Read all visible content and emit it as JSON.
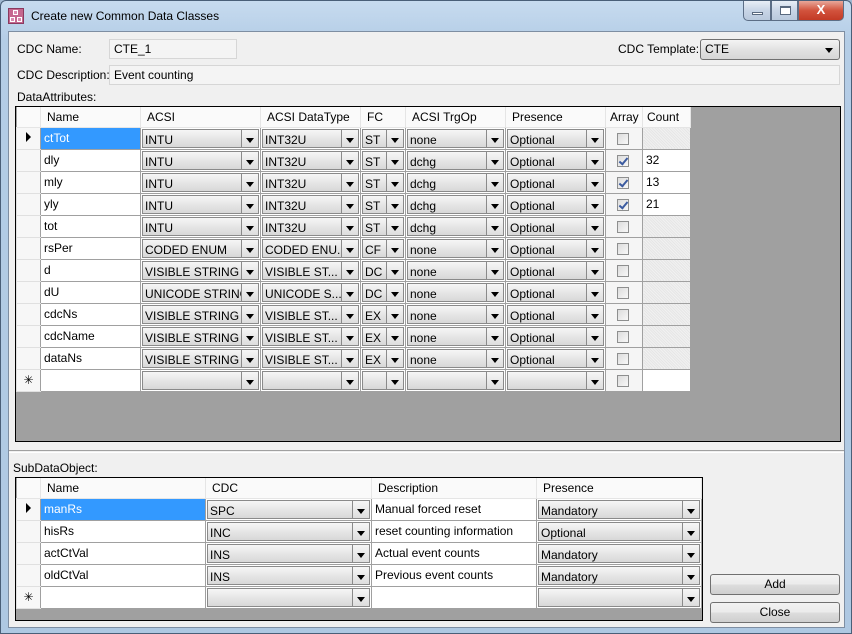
{
  "window": {
    "title": "Create new Common Data Classes",
    "icon": "cdc-classes-icon",
    "controls": {
      "minimize": "minimize",
      "maximize": "maximize",
      "close": "X"
    }
  },
  "form": {
    "cdc_name_label": "CDC Name:",
    "cdc_name_value": "CTE_1",
    "cdc_template_label": "CDC Template:",
    "cdc_template_value": "CTE",
    "cdc_description_label": "CDC Description:",
    "cdc_description_value": "Event counting"
  },
  "data_attributes": {
    "label": "DataAttributes:",
    "columns": [
      "Name",
      "ACSI",
      "ACSI DataType",
      "FC",
      "ACSI TrgOp",
      "Presence",
      "Array",
      "Count"
    ],
    "rows": [
      {
        "name": "ctTot",
        "acsi": "INTU",
        "datatype": "INT32U",
        "fc": "ST",
        "trgop": "none",
        "presence": "Optional",
        "array": false,
        "count": "",
        "selected": true
      },
      {
        "name": "dly",
        "acsi": "INTU",
        "datatype": "INT32U",
        "fc": "ST",
        "trgop": "dchg",
        "presence": "Optional",
        "array": true,
        "count": "32"
      },
      {
        "name": "mly",
        "acsi": "INTU",
        "datatype": "INT32U",
        "fc": "ST",
        "trgop": "dchg",
        "presence": "Optional",
        "array": true,
        "count": "13"
      },
      {
        "name": "yly",
        "acsi": "INTU",
        "datatype": "INT32U",
        "fc": "ST",
        "trgop": "dchg",
        "presence": "Optional",
        "array": true,
        "count": "21"
      },
      {
        "name": "tot",
        "acsi": "INTU",
        "datatype": "INT32U",
        "fc": "ST",
        "trgop": "dchg",
        "presence": "Optional",
        "array": false,
        "count": ""
      },
      {
        "name": "rsPer",
        "acsi": "CODED ENUM",
        "datatype": "CODED ENU...",
        "fc": "CF",
        "trgop": "none",
        "presence": "Optional",
        "array": false,
        "count": ""
      },
      {
        "name": "d",
        "acsi": "VISIBLE STRING",
        "datatype": "VISIBLE ST...",
        "fc": "DC",
        "trgop": "none",
        "presence": "Optional",
        "array": false,
        "count": ""
      },
      {
        "name": "dU",
        "acsi": "UNICODE STRING",
        "datatype": "UNICODE S...",
        "fc": "DC",
        "trgop": "none",
        "presence": "Optional",
        "array": false,
        "count": ""
      },
      {
        "name": "cdcNs",
        "acsi": "VISIBLE STRING",
        "datatype": "VISIBLE ST...",
        "fc": "EX",
        "trgop": "none",
        "presence": "Optional",
        "array": false,
        "count": ""
      },
      {
        "name": "cdcName",
        "acsi": "VISIBLE STRING",
        "datatype": "VISIBLE ST...",
        "fc": "EX",
        "trgop": "none",
        "presence": "Optional",
        "array": false,
        "count": ""
      },
      {
        "name": "dataNs",
        "acsi": "VISIBLE STRING",
        "datatype": "VISIBLE ST...",
        "fc": "EX",
        "trgop": "none",
        "presence": "Optional",
        "array": false,
        "count": ""
      }
    ],
    "new_row_marker": "✳"
  },
  "sub_data_objects": {
    "label": "SubDataObject:",
    "columns": [
      "Name",
      "CDC",
      "Description",
      "Presence"
    ],
    "rows": [
      {
        "name": "manRs",
        "cdc": "SPC",
        "description": "Manual forced reset",
        "presence": "Mandatory",
        "selected": true
      },
      {
        "name": "hisRs",
        "cdc": "INC",
        "description": "reset counting information",
        "presence": "Optional"
      },
      {
        "name": "actCtVal",
        "cdc": "INS",
        "description": "Actual event counts",
        "presence": "Mandatory"
      },
      {
        "name": "oldCtVal",
        "cdc": "INS",
        "description": "Previous event counts",
        "presence": "Mandatory"
      }
    ],
    "new_row_marker": "✳"
  },
  "buttons": {
    "add": "Add",
    "close": "Close"
  },
  "colors": {
    "selection": "#3399ff",
    "grid_background": "#a0a0a0",
    "close_button": "#c33a25"
  }
}
